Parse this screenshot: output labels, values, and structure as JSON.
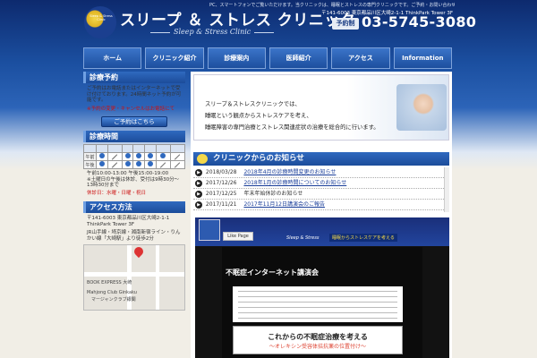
{
  "header": {
    "logo_badge": "Sleep & Stress Clinic",
    "title_ja": "スリープ ＆ ストレス クリニック",
    "title_en": "Sleep & Stress Clinic",
    "notice": "PC、スマートフォンでご覧いただけます。当クリニックは、睡眠とストレスの専門クリニックです。ご予約・お問い合わせはお電話にて 受付時間内",
    "address": "〒141-6003 東京都品川区大崎2-1-1 ThinkPark Tower 3F",
    "reserve_label": "予約制",
    "phone": "03-5745-3080"
  },
  "nav": {
    "items": [
      "ホーム",
      "クリニック紹介",
      "診療案内",
      "医師紹介",
      "アクセス",
      "Information"
    ]
  },
  "sidebar": {
    "reservation": {
      "heading": "診療予約",
      "text": "ご予約はお電話またはインターネットで受け付けております。24時間ネット予約が可能です。",
      "note": "※予約の変更・キャンセルはお電話にて",
      "button": "ご予約はこちら"
    },
    "hours": {
      "heading": "診療時間",
      "rows": [
        {
          "label": "午前",
          "cells": [
            "dot",
            "slash",
            "dot",
            "dot",
            "dot",
            "dot",
            "slash"
          ]
        },
        {
          "label": "午後",
          "cells": [
            "dot",
            "slash",
            "dot",
            "dot",
            "dot",
            "slash",
            "slash"
          ]
        }
      ],
      "times": "午前10:00-13:00 午後15:00-19:00",
      "note": "※土曜日の午後は休診、受付は9時30分〜13時30分まで",
      "closed": "休診日：水曜・日曜・祝日"
    },
    "access": {
      "heading": "アクセス方法",
      "address_1": "〒141-6003 東京都品川区大崎2-1-1",
      "address_2": "ThinkPark Tower 3F",
      "directions": "JR山手線・埼京線・湘南新宿ライン・りんかい線「大崎駅」より徒歩2分",
      "map_labels": [
        "BOOK EXPRESS 大崎",
        "Mahjong Club Ginkaku",
        "マージャンクラブ銀閣"
      ]
    }
  },
  "main": {
    "banner_lines": [
      "スリープ＆ストレスクリニックでは、",
      "睡眠という観点からストレスケアを考え、",
      "睡眠障害の専門治療とストレス関連症状の治療を総合的に行います。"
    ],
    "news_heading": "クリニックからのお知らせ",
    "news": [
      {
        "date": "2018/03/28",
        "title": "2018年4月の診療時間変更のお知らせ"
      },
      {
        "date": "2017/12/26",
        "title": "2018年1月の診療時間についてのお知らせ"
      },
      {
        "date": "2017/12/25",
        "title": "年末年始休診のお知らせ"
      },
      {
        "date": "2017/11/21",
        "title": "2017年11月12日講演会のご報告"
      }
    ],
    "facebook": {
      "like_label": "Like Page",
      "brand": "Sleep & Stress",
      "tagline": "睡眠からストレスケアを考える",
      "post_title": "不眠症インターネット講演会",
      "banner_title": "これからの不眠症治療を考える",
      "banner_sub": "〜オレキシン受容体拮抗薬の位置付け〜"
    }
  }
}
